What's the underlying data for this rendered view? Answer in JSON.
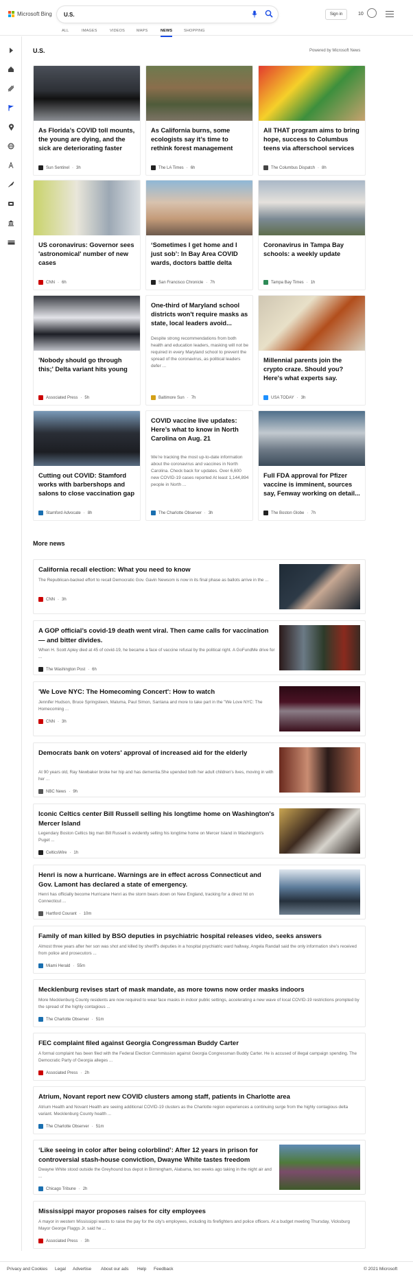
{
  "header": {
    "brand": "Microsoft Bing",
    "brand_colors": [
      "#f25022",
      "#7fba00",
      "#00a4ef",
      "#ffb900"
    ],
    "search": {
      "value": "U.S.",
      "placeholder": ""
    },
    "icons": [
      "microphone-icon",
      "search-icon",
      "rewards-icon",
      "hamburger-menu-icon"
    ],
    "signin_label": "Sign in",
    "rewards_count": "10",
    "accent": "#174ae4"
  },
  "tabs": [
    {
      "label": "ALL"
    },
    {
      "label": "IMAGES"
    },
    {
      "label": "VIDEOS"
    },
    {
      "label": "MAPS"
    },
    {
      "label": "NEWS",
      "active": true
    },
    {
      "label": "SHOPPING"
    }
  ],
  "sidebar": {
    "icons": [
      "expand-arrow-icon",
      "home-icon",
      "sports-icon",
      "politics-flag-icon",
      "local-pin-icon",
      "world-globe-icon",
      "science-icon",
      "technology-rocket-icon",
      "entertainment-icon",
      "business-icon",
      "money-icon"
    ]
  },
  "main": {
    "section_title": "U.S.",
    "powered_by": "Powered by Microsoft News",
    "cards": [
      {
        "title": "As Florida’s COVID toll mounts, the young are dying, and the sick are deteriorating faster",
        "source": "Sun Sentinel",
        "age": "3h",
        "src_color": "#222"
      },
      {
        "title": "As California burns, some ecologists say it’s time to rethink forest management",
        "source": "The LA Times",
        "age": "6h",
        "src_color": "#222"
      },
      {
        "title": "All THAT program aims to bring hope, success to Columbus teens via afterschool services",
        "source": "The Columbus Dispatch",
        "age": "8h",
        "src_color": "#444"
      },
      {
        "title": "US coronavirus: Governor sees 'astronomical' number of new cases",
        "source": "CNN",
        "age": "6h",
        "src_color": "#cc0000"
      },
      {
        "title": "‘Sometimes I get home and I just sob’: In Bay Area COVID wards, doctors battle delta",
        "source": "San Francisco Chronicle",
        "age": "7h",
        "src_color": "#222"
      },
      {
        "title": "Coronavirus in Tampa Bay schools: a weekly update",
        "source": "Tampa Bay Times",
        "age": "1h",
        "src_color": "#2e8b57"
      },
      {
        "title": "'Nobody should go through this;' Delta variant hits young",
        "source": "Associated Press",
        "age": "5h",
        "src_color": "#cc0000"
      },
      {
        "title": "One-third of Maryland school districts won't require masks as state, local leaders avoid...",
        "description": "Despite strong recommendations from both health and education leaders, masking will not be required in every Maryland school to prevent the spread of the coronavirus, as political leaders defer ...",
        "source": "Baltimore Sun",
        "age": "7h",
        "src_color": "#d4a017"
      },
      {
        "title": "Millennial parents join the crypto craze. Should you? Here's what experts say.",
        "source": "USA TODAY",
        "age": "3h",
        "src_color": "#1e90ff"
      },
      {
        "title": "Cutting out COVID: Stamford works with barbershops and salons to close vaccination gap",
        "source": "Stamford Advocate",
        "age": "8h",
        "src_color": "#1a6fb0"
      },
      {
        "title": "COVID vaccine live updates: Here’s what to know in North Carolina on Aug. 21",
        "description": "We’re tracking the most up-to-date information about the coronavirus and vaccines in North Carolina. Check back for updates. Over 6,600 new COVID-19 cases reported At least 1,144,894 people in North ...",
        "source": "The Charlotte Observer",
        "age": "3h",
        "src_color": "#1a6fb0"
      },
      {
        "title": "Full FDA approval for Pfizer vaccine is imminent, sources say, Fenway working on detail...",
        "source": "The Boston Globe",
        "age": "7h",
        "src_color": "#222"
      }
    ]
  },
  "more_news": {
    "title": "More news",
    "items": [
      {
        "title": "California recall election: What you need to know",
        "description": "The Republican-backed effort to recall Democratic Gov. Gavin Newsom is now in its final phase as ballots arrive in the ...",
        "source": "CNN",
        "age": "3h",
        "src_color": "#cc0000",
        "has_image": true
      },
      {
        "title": "A GOP official’s covid-19 death went viral. Then came calls for vaccination — and bitter divides.",
        "description": "When H. Scott Apley died at 45 of covid-19, he became a face of vaccine refusal by the political right. A GoFundMe drive for ...",
        "source": "The Washington Post",
        "age": "6h",
        "src_color": "#222",
        "has_image": true
      },
      {
        "title": "'We Love NYC: The Homecoming Concert': How to watch",
        "description": "Jennifer Hudson, Bruce Springsteen, Maluma, Paul Simon, Santana and more to take part in the \"We Love NYC: The Homecoming ...",
        "source": "CNN",
        "age": "3h",
        "src_color": "#cc0000",
        "has_image": true
      },
      {
        "title": "Democrats bank on voters' approval of increased aid for the elderly",
        "description": "At 90 years old, Ray Newbaker broke her hip and has dementia.She upended both her adult children's lives, moving in with her ...",
        "source": "NBC News",
        "age": "9h",
        "src_color": "#555",
        "has_image": true
      },
      {
        "title": "Iconic Celtics center Bill Russell selling his longtime home on Washington's Mercer Island",
        "description": "Legendary Boston Celtics big man Bill Russell is evidently selling his longtime home on Mercer Island in Washington's Puget ...",
        "source": "CelticsWire",
        "age": "1h",
        "src_color": "#222",
        "has_image": true
      },
      {
        "title": "Henri is now a hurricane. Warnings are in effect across Connecticut and Gov. Lamont has declared a state of emergency.",
        "description": "Henri has officially become Hurricane Henri as the storm bears down on New England, tracking for a direct hit on Connecticut ...",
        "source": "Hartford Courant",
        "age": "10m",
        "src_color": "#555",
        "has_image": true
      },
      {
        "title": "Family of man killed by BSO deputies in psychiatric hospital releases video, seeks answers",
        "description": "Almost three years after her son was shot and killed by sheriff's deputies in a hospital psychiatric ward hallway, Angela Randall said the only information she's received from police and prosecutors ...",
        "source": "Miami Herald",
        "age": "55m",
        "src_color": "#1a6fb0",
        "has_image": false
      },
      {
        "title": "Mecklenburg revises start of mask mandate, as more towns now order masks indoors",
        "description": "More Mecklenburg County residents are now required to wear face masks in indoor public settings, accelerating a new wave of local COVID-19 restrictions prompted by the spread of the highly contagious ...",
        "source": "The Charlotte Observer",
        "age": "51m",
        "src_color": "#1a6fb0",
        "has_image": false
      },
      {
        "title": "FEC complaint filed against Georgia Congressman Buddy Carter",
        "description": "A formal complaint has been filed with the Federal Election Commission against Georgia Congressman Buddy Carter. He is accused of illegal campaign spending. The Democratic Party of Georgia alleges ...",
        "source": "Associated Press",
        "age": "2h",
        "src_color": "#cc0000",
        "has_image": false
      },
      {
        "title": "Atrium, Novant report new COVID clusters among staff, patients in Charlotte area",
        "description": "Atrium Health and Novant Health are seeing additional COVID-19 clusters as the Charlotte region experiences a continuing surge from the highly contagious delta variant. Mecklenburg County health ...",
        "source": "The Charlotte Observer",
        "age": "51m",
        "src_color": "#1a6fb0",
        "has_image": false
      },
      {
        "title": "‘Like seeing in color after being colorblind’: After 12 years in prison for controversial stash-house conviction, Dwayne White tastes freedom",
        "description": "Dwayne White stood outside the Greyhound bus depot in Birmingham, Alabama, two weeks ago taking in the night air and ...",
        "source": "Chicago Tribune",
        "age": "2h",
        "src_color": "#1a6fb0",
        "has_image": true
      },
      {
        "title": "Mississippi mayor proposes raises for city employees",
        "description": "A mayor in western Mississippi wants to raise the pay for the city's employees, including its firefighters and police officers. At a budget meeting Thursday, Vicksburg Mayor George Flaggs Jr. said he ...",
        "source": "Associated Press",
        "age": "3h",
        "src_color": "#cc0000",
        "has_image": false
      }
    ]
  },
  "footer": {
    "links": [
      "Privacy and Cookies",
      "Legal",
      "Advertise",
      "About our ads",
      "Help",
      "Feedback"
    ],
    "copyright": "© 2021 Microsoft"
  }
}
